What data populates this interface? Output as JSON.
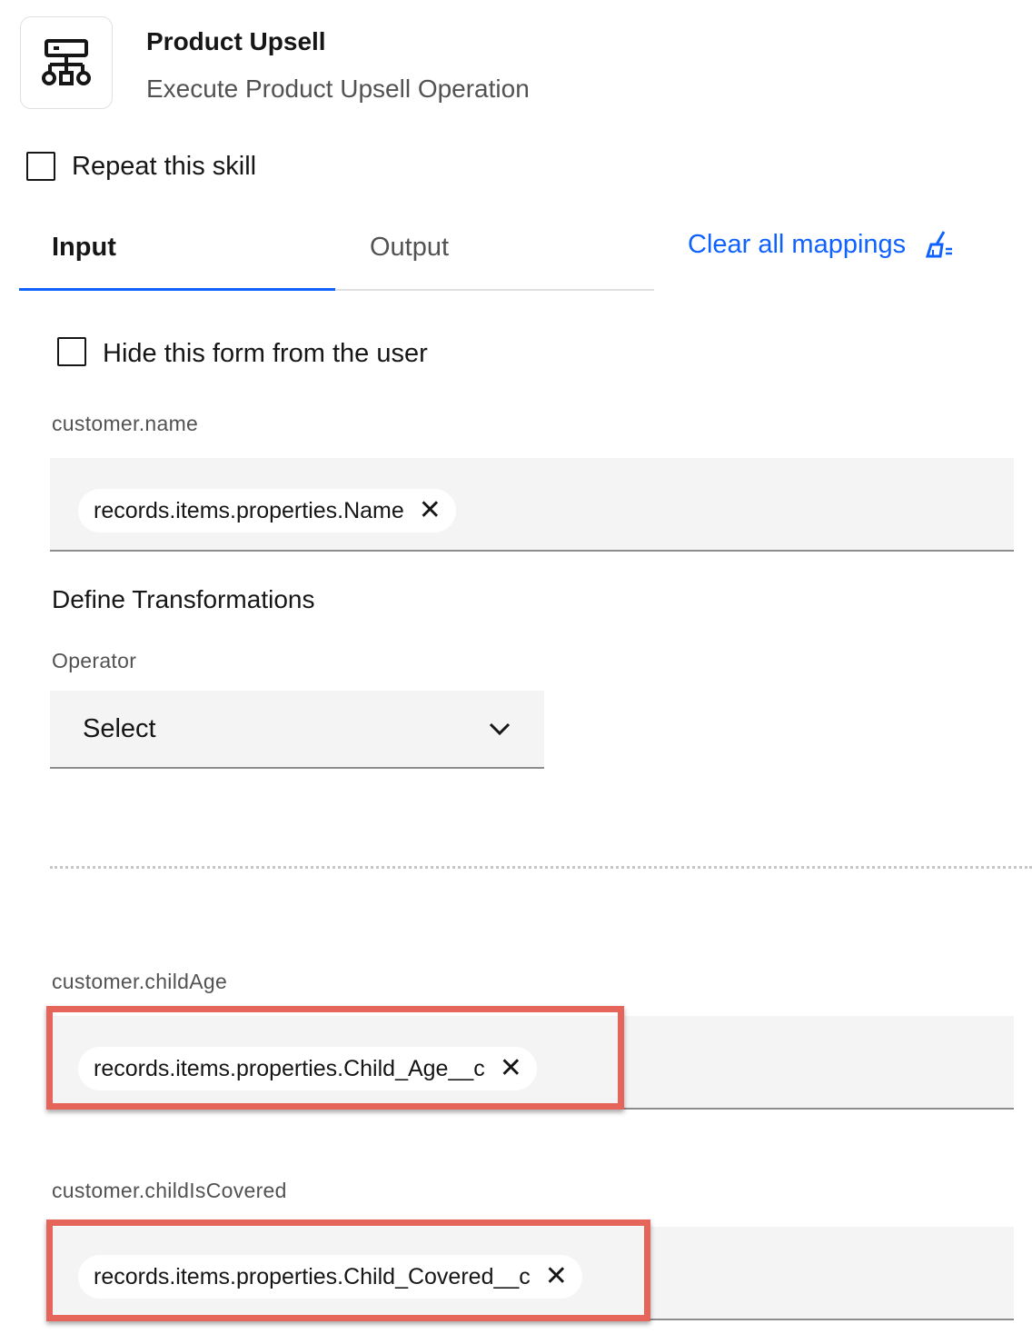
{
  "header": {
    "icon": "workflow-tree-icon",
    "title": "Product Upsell",
    "subtitle": "Execute Product Upsell Operation"
  },
  "repeat_skill": {
    "label": "Repeat this skill",
    "checked": false
  },
  "tabs": [
    {
      "label": "Input",
      "active": true
    },
    {
      "label": "Output",
      "active": false
    }
  ],
  "clear_mappings": {
    "label": "Clear all mappings",
    "icon": "broom-icon"
  },
  "hide_form": {
    "label": "Hide this form from the user",
    "checked": false
  },
  "fields": [
    {
      "label": "customer.name",
      "tag": "records.items.properties.Name",
      "highlighted": false
    },
    {
      "label": "customer.childAge",
      "tag": "records.items.properties.Child_Age__c",
      "highlighted": true
    },
    {
      "label": "customer.childIsCovered",
      "tag": "records.items.properties.Child_Covered__c",
      "highlighted": true
    }
  ],
  "transformations": {
    "title": "Define Transformations",
    "operator_label": "Operator",
    "operator_value": "Select"
  },
  "colors": {
    "accent": "#0f62fe",
    "highlight": "#e5655a",
    "field_bg": "#f4f4f4"
  }
}
